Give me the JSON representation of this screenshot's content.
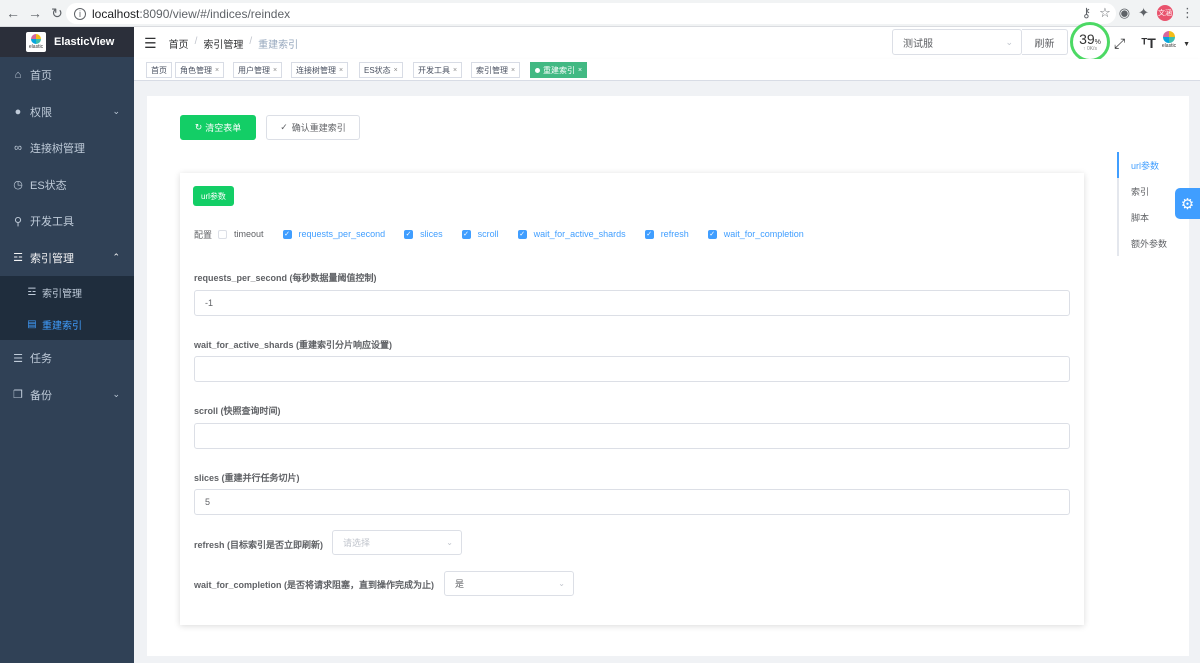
{
  "browser": {
    "url_host": "localhost",
    "url_path": ":8090/view/#/indices/reindex",
    "profile_label": "文涵"
  },
  "sidebar": {
    "app_title": "ElasticView",
    "logo_text": "elastic",
    "items": [
      {
        "label": "首页",
        "icon": "home-icon"
      },
      {
        "label": "权限",
        "icon": "user-icon",
        "arrow": "chevron-down-icon"
      },
      {
        "label": "连接树管理",
        "icon": "link-icon"
      },
      {
        "label": "ES状态",
        "icon": "clock-icon"
      },
      {
        "label": "开发工具",
        "icon": "search-icon"
      },
      {
        "label": "索引管理",
        "icon": "database-icon",
        "arrow": "chevron-up-icon"
      },
      {
        "label": "任务",
        "icon": "list-icon"
      },
      {
        "label": "备份",
        "icon": "copy-icon",
        "arrow": "chevron-down-icon"
      }
    ],
    "sub_items": [
      {
        "label": "索引管理",
        "icon": "database-icon"
      },
      {
        "label": "重建索引",
        "icon": "document-icon",
        "active": true
      }
    ]
  },
  "header": {
    "breadcrumb": [
      "首页",
      "索引管理",
      "重建索引"
    ],
    "env_select_value": "测试服",
    "refresh_label": "刷新",
    "gauge_percent": "39",
    "gauge_percent_unit": "%",
    "gauge_speed": "0K/s",
    "avatar_label": "elastic"
  },
  "tags": [
    {
      "label": "首页"
    },
    {
      "label": "角色管理"
    },
    {
      "label": "用户管理"
    },
    {
      "label": "连接树管理"
    },
    {
      "label": "ES状态"
    },
    {
      "label": "开发工具"
    },
    {
      "label": "索引管理"
    },
    {
      "label": "重建索引",
      "active": true
    }
  ],
  "actions": {
    "clear_label": "清空表单",
    "confirm_label": "确认重建索引"
  },
  "form": {
    "section_tag": "url参数",
    "config_label": "配置",
    "checkboxes": [
      {
        "label": "timeout",
        "checked": false
      },
      {
        "label": "requests_per_second",
        "checked": true
      },
      {
        "label": "slices",
        "checked": true
      },
      {
        "label": "scroll",
        "checked": true
      },
      {
        "label": "wait_for_active_shards",
        "checked": true
      },
      {
        "label": "refresh",
        "checked": true
      },
      {
        "label": "wait_for_completion",
        "checked": true
      }
    ],
    "fields": {
      "rps_label": "requests_per_second (每秒数据量阈值控制)",
      "rps_value": "-1",
      "shards_label": "wait_for_active_shards (重建索引分片响应设置)",
      "shards_value": "",
      "scroll_label": "scroll (快照查询时间)",
      "scroll_value": "",
      "slices_label": "slices (重建并行任务切片)",
      "slices_value": "5",
      "refresh_label": "refresh (目标索引是否立即刷新)",
      "refresh_placeholder": "请选择",
      "wfc_label": "wait_for_completion (是否将请求阻塞，直到操作完成为止)",
      "wfc_value": "是"
    }
  },
  "anchor_nav": {
    "items": [
      "url参数",
      "索引",
      "脚本",
      "额外参数"
    ],
    "active_index": 0
  }
}
